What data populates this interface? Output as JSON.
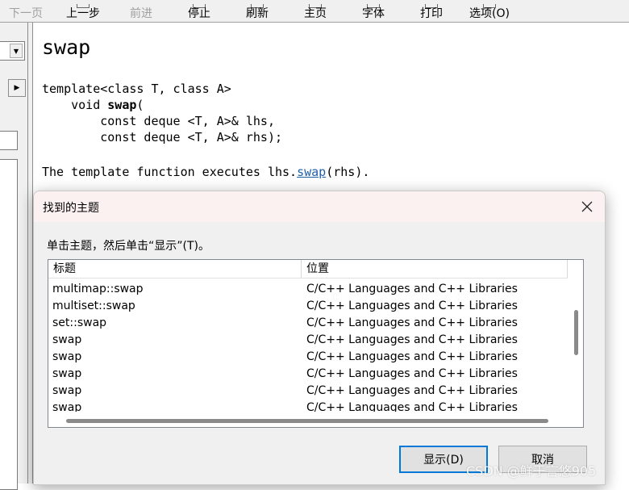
{
  "toolbar": {
    "buttons": [
      {
        "label": "下一页",
        "enabled": false
      },
      {
        "label": "上一步",
        "enabled": true
      },
      {
        "label": "前进",
        "enabled": false
      },
      {
        "label": "停止",
        "enabled": true
      },
      {
        "label": "刷新",
        "enabled": true
      },
      {
        "label": "主页",
        "enabled": true
      },
      {
        "label": "字体",
        "enabled": true
      },
      {
        "label": "打印",
        "enabled": true
      },
      {
        "label": "选项(O)",
        "enabled": true
      }
    ]
  },
  "topic": {
    "title": "swap",
    "code_line1": "template<class T, class A>",
    "code_line2_prefix": "    void ",
    "code_line2_func": "swap",
    "code_line2_suffix": "(",
    "code_line3": "        const deque <T, A>& lhs,",
    "code_line4": "        const deque <T, A>& rhs);",
    "desc_prefix": "The template function executes lhs.",
    "desc_link": "swap",
    "desc_suffix": "(rhs)."
  },
  "dialog": {
    "title": "找到的主题",
    "close_glyph": "✕",
    "instruction": "单击主题，然后单击“显示”(T)。",
    "columns": [
      "标题",
      "位置"
    ],
    "rows": [
      {
        "title": "multimap::swap",
        "location": "C/C++ Languages and C++ Libraries"
      },
      {
        "title": "multiset::swap",
        "location": "C/C++ Languages and C++ Libraries"
      },
      {
        "title": "set::swap",
        "location": "C/C++ Languages and C++ Libraries"
      },
      {
        "title": "swap",
        "location": "C/C++ Languages and C++ Libraries"
      },
      {
        "title": "swap",
        "location": "C/C++ Languages and C++ Libraries"
      },
      {
        "title": "swap",
        "location": "C/C++ Languages and C++ Libraries"
      },
      {
        "title": "swap",
        "location": "C/C++ Languages and C++ Libraries"
      },
      {
        "title": "swap",
        "location": "C/C++ Languages and C++ Libraries"
      }
    ],
    "show_button": "显示(D)",
    "cancel_button": "取消"
  },
  "watermark": "CSDN @鲜于言悠905",
  "colors": {
    "link": "#1f5fa8",
    "focus_border": "#0078d7",
    "dialog_title_bg": "#faf1f0"
  }
}
